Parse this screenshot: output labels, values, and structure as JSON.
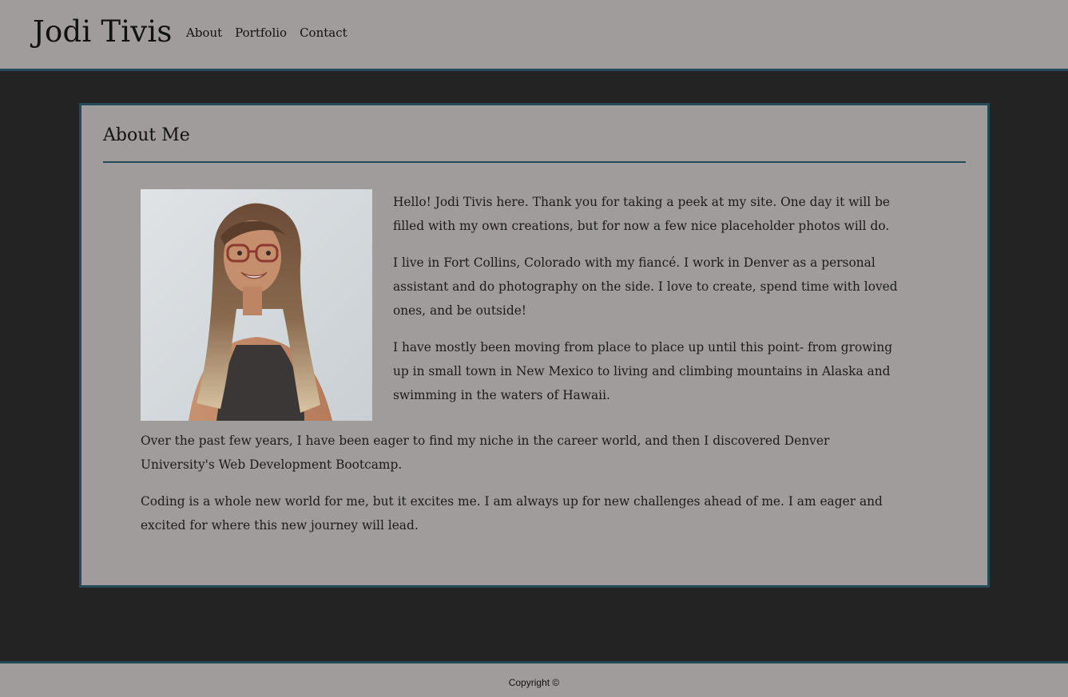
{
  "header": {
    "site_title": "Jodi Tivis",
    "nav": [
      "About",
      "Portfolio",
      "Contact"
    ]
  },
  "about": {
    "title": "About Me",
    "photo_alt": "Portrait of Jodi Tivis",
    "paragraphs": [
      "Hello! Jodi Tivis here. Thank you for taking a peek at my site. One day it will be filled with my own creations, but for now a few nice placeholder photos will do.",
      "I live in Fort Collins, Colorado with my fiancé. I work in Denver as a personal assistant and do photography on the side. I love to create, spend time with loved ones, and be outside!",
      "I have mostly been moving from place to place up until this point- from growing up in small town in New Mexico to living and climbing mountains in Alaska and swimming in the waters of Hawaii.",
      "Over the past few years, I have been eager to find my niche in the career world, and then I discovered Denver University's Web Development Bootcamp.",
      "Coding is a whole new world for me, but it excites me. I am always up for new challenges ahead of me. I am eager and excited for where this new journey will lead."
    ]
  },
  "footer": {
    "copyright": "Copyright ©"
  },
  "colors": {
    "panel_bg": "#a19c9c",
    "page_bg": "#232323",
    "accent_border": "#244a5a"
  }
}
